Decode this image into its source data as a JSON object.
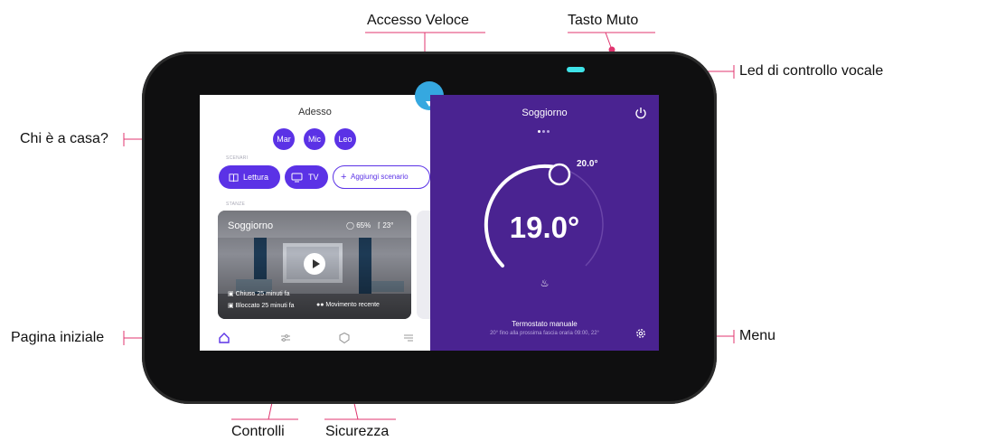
{
  "callouts": {
    "accesso_veloce": "Accesso Veloce",
    "tasto_muto": "Tasto Muto",
    "led_vocale": "Led di controllo vocale",
    "chi_e_a_casa": "Chi è a casa?",
    "pagina_iniziale": "Pagina iniziale",
    "menu": "Menu",
    "controlli": "Controlli",
    "sicurezza": "Sicurezza"
  },
  "colors": {
    "callout_line": "#e0356f",
    "accent_purple": "#5b32e6",
    "thermostat_bg": "#4a2391",
    "quick_access_blue": "#35a8e0",
    "led_cyan": "#3fe3e8"
  },
  "home": {
    "title": "Adesso",
    "people": [
      "Mar",
      "Mic",
      "Leo"
    ],
    "scenari_label": "SCENARI",
    "scenarios": [
      {
        "label": "Lettura",
        "icon": "book-icon"
      },
      {
        "label": "TV",
        "icon": "tv-icon"
      },
      {
        "label": "Aggiungi scenario",
        "icon": "plus-icon"
      }
    ],
    "stanze_label": "STANZE",
    "room": {
      "name": "Soggiorno",
      "humidity": "65%",
      "temperature": "23°",
      "status_lines": [
        "Chiuso 25 minuti fa",
        "Bloccato 25 minuti fa"
      ],
      "motion": "Movimento recente"
    },
    "nav_icons": [
      "home-icon",
      "sliders-icon",
      "shield-icon",
      "menu-icon"
    ]
  },
  "thermostat": {
    "room": "Soggiorno",
    "current_temp": "19.0°",
    "setpoint": "20.0°",
    "mode": "Termostato manuale",
    "schedule_note": "20° fino alla prossima fascia oraria  09:00, 22°",
    "page_dots": 3,
    "active_dot": 0
  }
}
